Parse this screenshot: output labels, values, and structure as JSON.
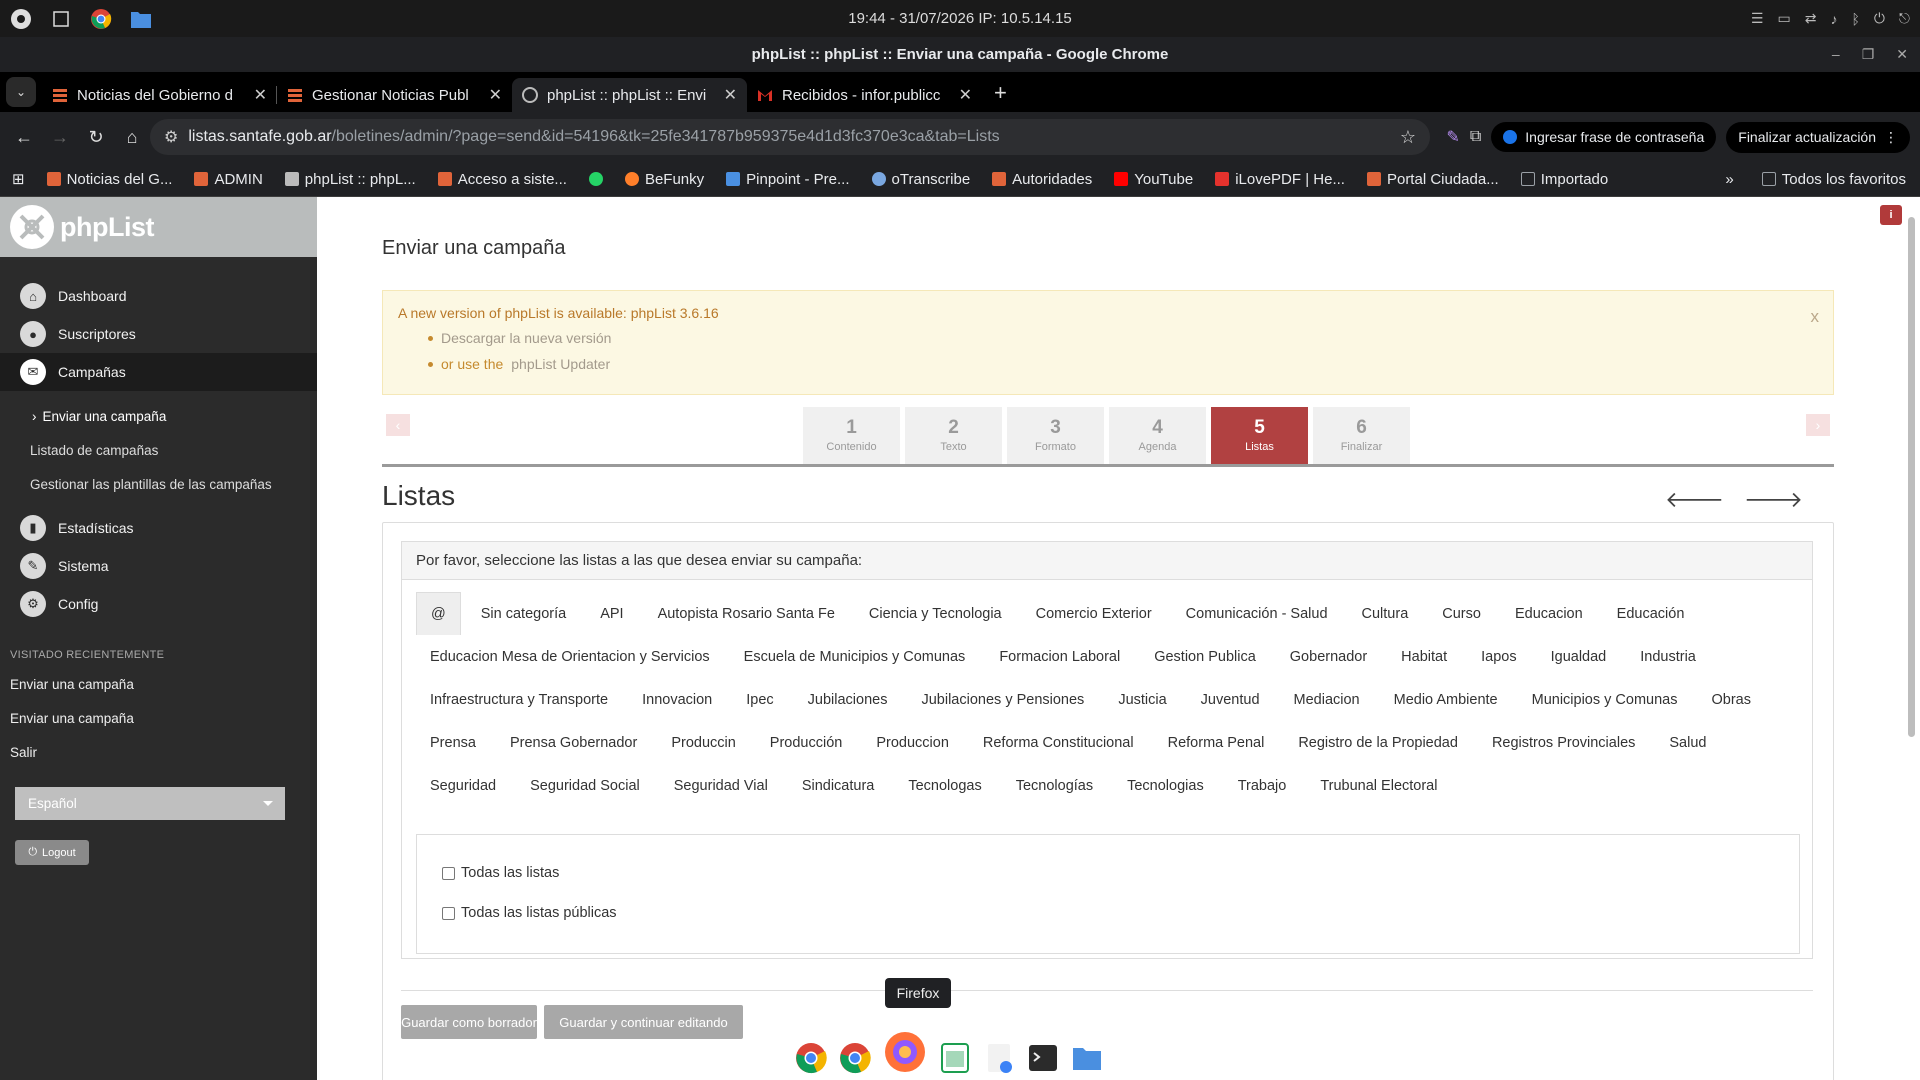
{
  "os": {
    "clock": "19:44  -  31/07/2026    IP: 10.5.14.15"
  },
  "window": {
    "title": "phpList :: phpList :: Enviar una campaña - Google Chrome"
  },
  "tabs": [
    {
      "title": "Noticias del Gobierno d",
      "favicon_color": "#e0643a",
      "active": false
    },
    {
      "title": "Gestionar Noticias Publ",
      "favicon_color": "#e0643a",
      "active": false
    },
    {
      "title": "phpList :: phpList :: Envi",
      "favicon_color": "#bbbbbb",
      "active": true
    },
    {
      "title": "Recibidos - infor.publicc",
      "favicon_color": "#d93025",
      "active": false
    }
  ],
  "address": {
    "host": "listas.santafe.gob.ar",
    "path": "/boletines/admin/?page=send&id=54196&tk=25fe341787b959375e4d1d3fc370e3ca&tab=Lists"
  },
  "toolbar": {
    "passphrase_label": "Ingresar frase de contraseña",
    "update_label": "Finalizar actualización"
  },
  "bookmarks": [
    {
      "label": "Noticias del G...",
      "color": "#e0643a"
    },
    {
      "label": "ADMIN",
      "color": "#e0643a"
    },
    {
      "label": "phpList :: phpL...",
      "color": "#bbbbbb"
    },
    {
      "label": "Acceso a siste...",
      "color": "#e0643a"
    },
    {
      "label": "",
      "color": "#25d366"
    },
    {
      "label": "BeFunky",
      "color": "#ff7f2a"
    },
    {
      "label": "Pinpoint - Pre...",
      "color": "#4a90e2"
    },
    {
      "label": "oTranscribe",
      "color": "#7aa7e0"
    },
    {
      "label": "Autoridades",
      "color": "#e0643a"
    },
    {
      "label": "YouTube",
      "color": "#ff0000"
    },
    {
      "label": "iLovePDF | He...",
      "color": "#e5322d"
    },
    {
      "label": "Portal Ciudada...",
      "color": "#e0643a"
    },
    {
      "label": "Importado",
      "color": "#9aa0a6"
    }
  ],
  "bookmarks_all": "Todos los favoritos",
  "sidebar": {
    "brand": "phpList",
    "menu": [
      {
        "label": "Dashboard",
        "icon": "home-icon"
      },
      {
        "label": "Suscriptores",
        "icon": "user-icon"
      },
      {
        "label": "Campañas",
        "icon": "envelope-icon"
      }
    ],
    "submenu": [
      "Enviar una campaña",
      "Listado de campañas",
      "Gestionar las plantillas de las campañas"
    ],
    "menu2": [
      {
        "label": "Estadísticas",
        "icon": "chart-icon"
      },
      {
        "label": "Sistema",
        "icon": "wrench-icon"
      },
      {
        "label": "Config",
        "icon": "gear-icon"
      }
    ],
    "recent_heading": "VISITADO RECIENTEMENTE",
    "recent": [
      "Enviar una campaña",
      "Enviar una campaña",
      "Salir"
    ],
    "language": "Español",
    "logout": "Logout"
  },
  "main": {
    "title": "Enviar una campaña",
    "alert": {
      "text": "A new version of phpList is available: phpList 3.6.16",
      "item1": "Descargar la nueva versión",
      "item2_prefix": "or use the",
      "item2_link": "phpList Updater",
      "close": "x"
    },
    "steps": [
      {
        "n": "1",
        "label": "Contenido"
      },
      {
        "n": "2",
        "label": "Texto"
      },
      {
        "n": "3",
        "label": "Formato"
      },
      {
        "n": "4",
        "label": "Agenda"
      },
      {
        "n": "5",
        "label": "Listas"
      },
      {
        "n": "6",
        "label": "Finalizar"
      }
    ],
    "active_step": "5",
    "section_title": "Listas",
    "panel_heading": "Por favor, seleccione las listas a las que desea enviar su campaña:",
    "list_tabs": [
      "@",
      "Sin categoría",
      "API",
      "Autopista Rosario Santa Fe",
      "Ciencia y Tecnologia",
      "Comercio Exterior",
      "Comunicación - Salud",
      "Cultura",
      "Curso",
      "Educacion",
      "Educación",
      "Educacion Mesa de Orientacion y Servicios",
      "Escuela de Municipios y Comunas",
      "Formacion Laboral",
      "Gestion Publica",
      "Gobernador",
      "Habitat",
      "Iapos",
      "Igualdad",
      "Industria",
      "Infraestructura y Transporte",
      "Innovacion",
      "Ipec",
      "Jubilaciones",
      "Jubilaciones y Pensiones",
      "Justicia",
      "Juventud",
      "Mediacion",
      "Medio Ambiente",
      "Municipios y Comunas",
      "Obras",
      "Prensa",
      "Prensa Gobernador",
      "Produccin",
      "Producción",
      "Produccion",
      "Reforma Constitucional",
      "Reforma Penal",
      "Registro de la Propiedad",
      "Registros Provinciales",
      "Salud",
      "Seguridad",
      "Seguridad Social",
      "Seguridad Vial",
      "Sindicatura",
      "Tecnologas",
      "Tecnologías",
      "Tecnologias",
      "Trabajo",
      "Trubunal Electoral"
    ],
    "checkbox_all": "Todas las listas",
    "checkbox_public": "Todas las listas públicas",
    "save_draft": "Guardar como borrador",
    "save_continue": "Guardar y continuar editando"
  },
  "dock": {
    "tooltip": "Firefox"
  }
}
